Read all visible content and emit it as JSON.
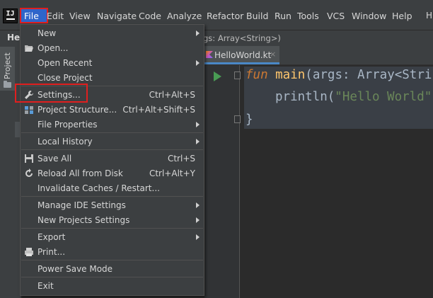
{
  "app": {
    "logo_text": "IJ"
  },
  "menubar": {
    "items": [
      "File",
      "Edit",
      "View",
      "Navigate",
      "Code",
      "Analyze",
      "Refactor",
      "Build",
      "Run",
      "Tools",
      "VCS",
      "Window",
      "Help"
    ],
    "title_fragment": "H"
  },
  "navbar": {
    "project_fragment": "He",
    "breadcrumb_fragment": "gs: Array<String>)"
  },
  "toolwindow": {
    "project_label": "Project"
  },
  "editor": {
    "tab_label": "HelloWorld.kt",
    "tab_close": "×",
    "code": {
      "line1_kw": "fun",
      "line1_fn": " main",
      "line1_rest": "(args: Array<Stri",
      "line2_call": "println(",
      "line2_str": "\"Hello World\"",
      "line3": "}"
    }
  },
  "file_menu": {
    "items": [
      {
        "label": "New",
        "shortcut": "",
        "submenu": true,
        "icon": ""
      },
      {
        "label": "Open...",
        "shortcut": "",
        "submenu": false,
        "icon": "folder-open-icon"
      },
      {
        "label": "Open Recent",
        "shortcut": "",
        "submenu": true,
        "icon": ""
      },
      {
        "label": "Close Project",
        "shortcut": "",
        "submenu": false,
        "icon": ""
      },
      {
        "label": "Settings...",
        "shortcut": "Ctrl+Alt+S",
        "submenu": false,
        "icon": "wrench-icon"
      },
      {
        "label": "Project Structure...",
        "shortcut": "Ctrl+Alt+Shift+S",
        "submenu": false,
        "icon": "project-structure-icon"
      },
      {
        "label": "File Properties",
        "shortcut": "",
        "submenu": true,
        "icon": ""
      },
      {
        "label": "Local History",
        "shortcut": "",
        "submenu": true,
        "icon": ""
      },
      {
        "label": "Save All",
        "shortcut": "Ctrl+S",
        "submenu": false,
        "icon": "save-icon"
      },
      {
        "label": "Reload All from Disk",
        "shortcut": "Ctrl+Alt+Y",
        "submenu": false,
        "icon": "reload-icon"
      },
      {
        "label": "Invalidate Caches / Restart...",
        "shortcut": "",
        "submenu": false,
        "icon": ""
      },
      {
        "label": "Manage IDE Settings",
        "shortcut": "",
        "submenu": true,
        "icon": ""
      },
      {
        "label": "New Projects Settings",
        "shortcut": "",
        "submenu": true,
        "icon": ""
      },
      {
        "label": "Export",
        "shortcut": "",
        "submenu": true,
        "icon": ""
      },
      {
        "label": "Print...",
        "shortcut": "",
        "submenu": false,
        "icon": "print-icon"
      },
      {
        "label": "Power Save Mode",
        "shortcut": "",
        "submenu": false,
        "icon": ""
      },
      {
        "label": "Exit",
        "shortcut": "",
        "submenu": false,
        "icon": ""
      }
    ]
  },
  "colors": {
    "menubar_bg": "#3c3f41",
    "editor_bg": "#2b2b2b",
    "highlight_red": "#e01f1f",
    "selection_blue": "#2f65ca"
  }
}
